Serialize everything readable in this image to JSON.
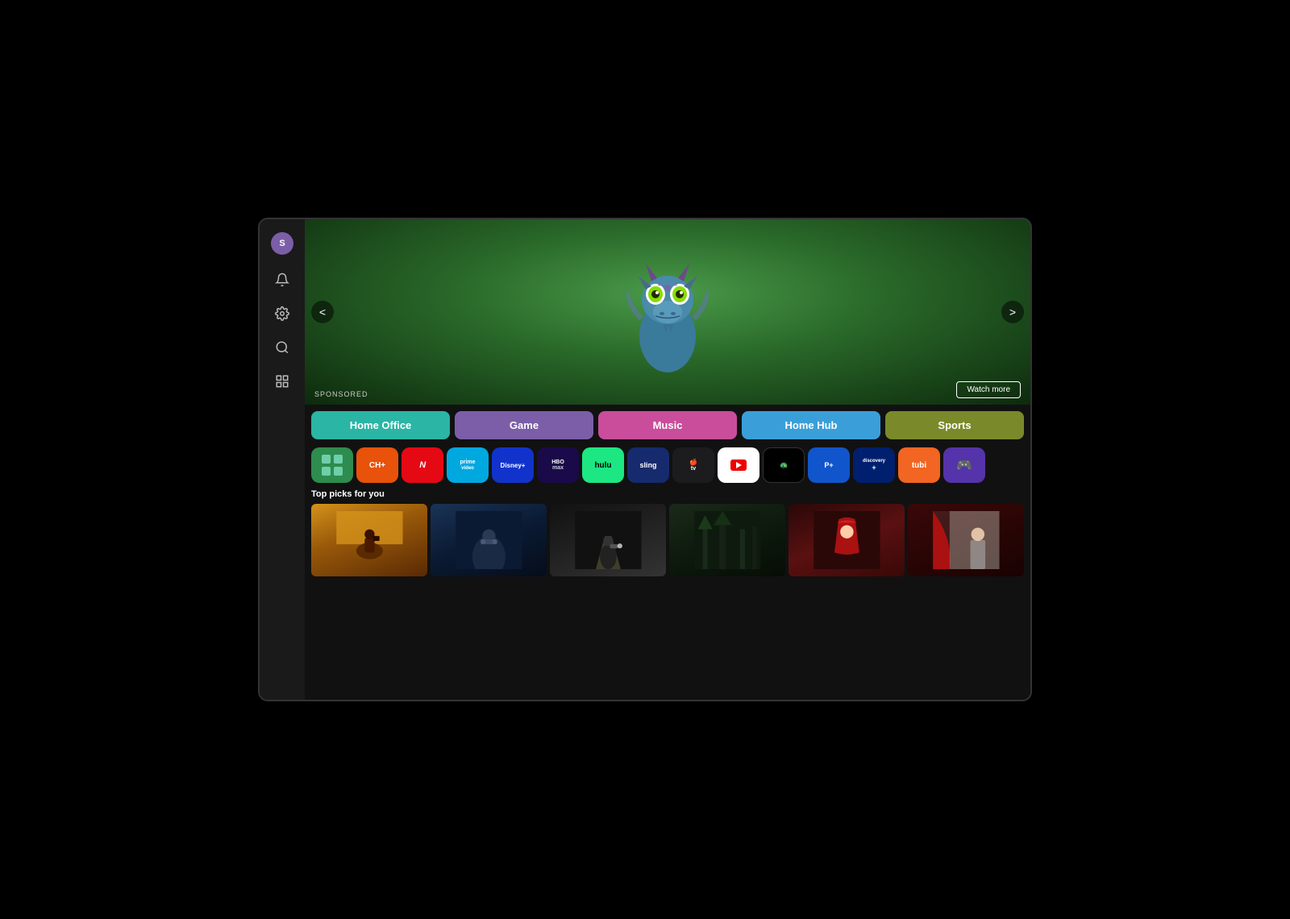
{
  "tv": {
    "sidebar": {
      "avatar_letter": "S",
      "avatar_color": "#7b5ea7",
      "icons": [
        "bell",
        "settings",
        "search",
        "list"
      ]
    },
    "hero": {
      "sponsored_label": "SPONSORED",
      "watch_more_label": "Watch more",
      "nav_left": "<",
      "nav_right": ">"
    },
    "categories": [
      {
        "id": "home-office",
        "label": "Home Office",
        "color": "#2ab5a5"
      },
      {
        "id": "game",
        "label": "Game",
        "color": "#7b5ea7"
      },
      {
        "id": "music",
        "label": "Music",
        "color": "#c94d9a"
      },
      {
        "id": "home-hub",
        "label": "Home Hub",
        "color": "#3a9fd9"
      },
      {
        "id": "sports",
        "label": "Sports",
        "color": "#7a8a2a"
      }
    ],
    "apps": [
      {
        "id": "apps",
        "label": "APPS",
        "bg": "#2d8c4e"
      },
      {
        "id": "ch",
        "label": "CH",
        "bg": "#e8520a"
      },
      {
        "id": "netflix",
        "label": "NETFLIX",
        "bg": "#e50914"
      },
      {
        "id": "prime",
        "label": "prime video",
        "bg": "#00a8e0"
      },
      {
        "id": "disney",
        "label": "Disney+",
        "bg": "#1133cc"
      },
      {
        "id": "hbomax",
        "label": "HBO max",
        "bg": "#1a0a4a"
      },
      {
        "id": "hulu",
        "label": "hulu",
        "bg": "#1ce783"
      },
      {
        "id": "sling",
        "label": "sling",
        "bg": "#162a6e"
      },
      {
        "id": "appletv",
        "label": "tv",
        "bg": "#1c1c1e"
      },
      {
        "id": "youtube",
        "label": "YouTube",
        "bg": "#fff"
      },
      {
        "id": "peacock",
        "label": "peacock",
        "bg": "#000"
      },
      {
        "id": "paramount",
        "label": "P+",
        "bg": "#1155cc"
      },
      {
        "id": "discovery",
        "label": "discovery+",
        "bg": "#001f6e"
      },
      {
        "id": "tubi",
        "label": "tubi",
        "bg": "#f26522"
      },
      {
        "id": "last",
        "label": "🎮",
        "bg": "#5533aa"
      }
    ],
    "top_picks": {
      "title": "Top picks for you",
      "items": [
        {
          "id": "pick-1"
        },
        {
          "id": "pick-2"
        },
        {
          "id": "pick-3"
        },
        {
          "id": "pick-4"
        },
        {
          "id": "pick-5"
        },
        {
          "id": "pick-6"
        }
      ]
    }
  }
}
